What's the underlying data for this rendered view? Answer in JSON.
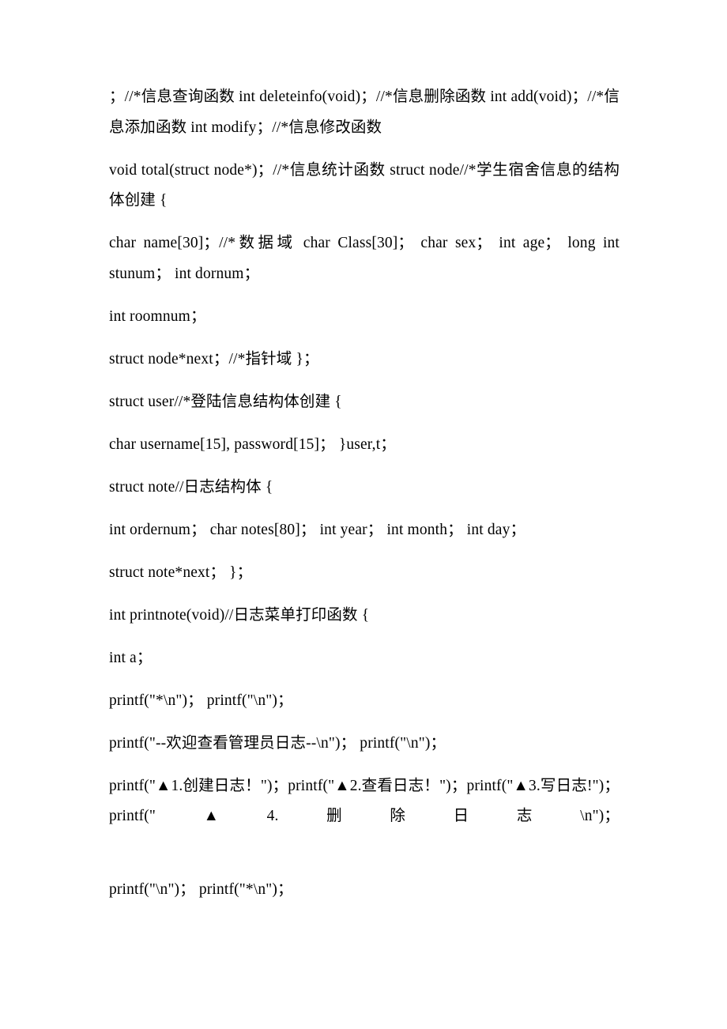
{
  "document": {
    "page_background": "#ffffff",
    "text_color": "#000000",
    "paragraphs": [
      {
        "id": "p1",
        "name": "code-paragraph-function-declarations",
        "text": "；//*信息查询函数 int deleteinfo(void)；//*信息删除函数 int add(void)；//*信息添加函数 int modify；//*信息修改函数"
      },
      {
        "id": "p2",
        "name": "code-paragraph-total-and-struct-node",
        "text": "void total(struct node*)；//*信息统计函数 struct node//*学生宿舍信息的结构体创建 {"
      },
      {
        "id": "p3",
        "name": "code-paragraph-node-fields-1",
        "text": "char name[30]；//*数据域 char Class[30]； char sex； int age； long int stunum； int dornum；"
      },
      {
        "id": "p4",
        "name": "code-paragraph-roomnum",
        "text": "int roomnum；"
      },
      {
        "id": "p5",
        "name": "code-paragraph-node-next",
        "text": "struct node*next；//*指针域 }；"
      },
      {
        "id": "p6",
        "name": "code-paragraph-struct-user",
        "text": "struct user//*登陆信息结构体创建 {"
      },
      {
        "id": "p7",
        "name": "code-paragraph-user-fields",
        "text": "char username[15], password[15]； }user,t；"
      },
      {
        "id": "p8",
        "name": "code-paragraph-struct-note",
        "text": "struct note//日志结构体 {"
      },
      {
        "id": "p9",
        "name": "code-paragraph-note-fields",
        "text": "int ordernum； char notes[80]； int year； int month； int day；"
      },
      {
        "id": "p10",
        "name": "code-paragraph-note-next",
        "text": "struct note*next； }；"
      },
      {
        "id": "p11",
        "name": "code-paragraph-printnote-signature",
        "text": "int printnote(void)//日志菜单打印函数 {"
      },
      {
        "id": "p12",
        "name": "code-paragraph-int-a",
        "text": "int a；"
      },
      {
        "id": "p13",
        "name": "code-paragraph-printf-star-newline",
        "text": "printf(\"*\\n\")； printf(\"\\n\")；"
      },
      {
        "id": "p14",
        "name": "code-paragraph-printf-welcome",
        "text": "printf(\"--欢迎查看管理员日志--\\n\")； printf(\"\\n\")；"
      },
      {
        "id": "p15",
        "name": "code-paragraph-printf-menu-items",
        "text": "printf(\"▲1.创建日志！\")；printf(\"▲2.查看日志！\")；printf(\"▲3.写日志!\")；printf(\"▲4.删除日志\\n\")；"
      },
      {
        "id": "p16",
        "name": "code-paragraph-printf-newline-star",
        "text": "printf(\"\\n\")； printf(\"*\\n\")；"
      }
    ]
  }
}
